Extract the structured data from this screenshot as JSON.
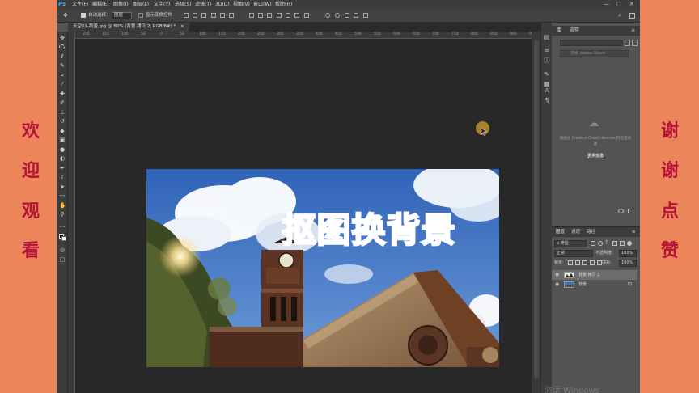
{
  "side_left": {
    "chars": [
      "欢",
      "迎",
      "观",
      "看"
    ]
  },
  "side_right": {
    "chars": [
      "谢",
      "谢",
      "点",
      "赞"
    ]
  },
  "app": {
    "logo": "Ps"
  },
  "menu": [
    "文件(F)",
    "编辑(E)",
    "图像(I)",
    "图层(L)",
    "文字(Y)",
    "选择(S)",
    "滤镜(T)",
    "3D(D)",
    "视图(V)",
    "窗口(W)",
    "帮助(H)"
  ],
  "window_controls": {
    "minimize": "—",
    "restore": "□",
    "close": "✕"
  },
  "options": {
    "move_glyph": "✥",
    "auto_select_label": "自动选择：",
    "auto_select_value": "图层",
    "show_transform_label": "显示变换控件"
  },
  "document_tab": {
    "title": "天空01-刮羞.jpg @ 50% (背景 拷贝 2, RGB/8#) *",
    "close": "×"
  },
  "ruler": {
    "h_ticks": [
      "200",
      "150",
      "100",
      "50",
      "0",
      "50",
      "100",
      "150",
      "200",
      "250",
      "300",
      "350",
      "400",
      "450",
      "500",
      "550",
      "600",
      "650",
      "700",
      "750",
      "800",
      "850",
      "900",
      "950",
      "1000"
    ]
  },
  "canvas_text": {
    "title": "抠图换背景"
  },
  "right_panel": {
    "tabs": [
      "库",
      "调整"
    ],
    "search_placeholder": "搜索 Adobe Stock",
    "cc_text": "初始化 Creative Cloud Libraries 时出现问题",
    "cc_link": "更多信息"
  },
  "layers_panel": {
    "tabs": [
      "图层",
      "通道",
      "路径"
    ],
    "filter_label": "ρ 类型",
    "blend_mode": "正常",
    "opacity_label": "不透明度:",
    "opacity_value": "100%",
    "lock_label": "锁定:",
    "fill_label": "填充:",
    "fill_value": "100%",
    "layers": [
      {
        "name": "背景 拷贝 2",
        "visible": true,
        "selected": true
      },
      {
        "name": "背景",
        "visible": true,
        "selected": false,
        "locked": true
      }
    ]
  },
  "watermark": "激活 Windows"
}
